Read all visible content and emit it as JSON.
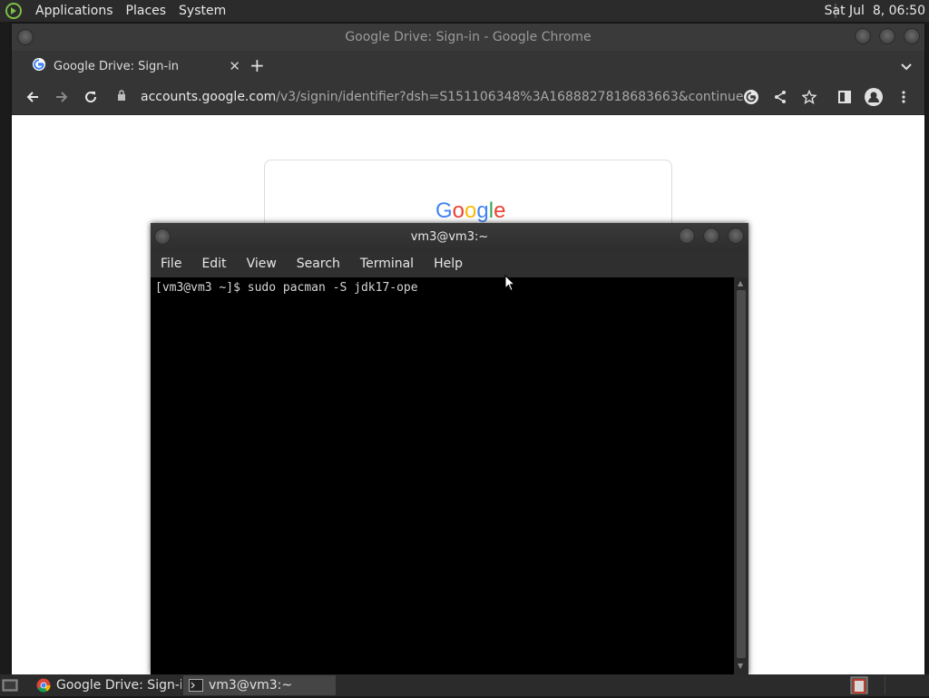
{
  "top_panel": {
    "menu": [
      "Applications",
      "Places",
      "System"
    ],
    "clock": "Sat Jul  8, 06:50",
    "logo_icon": "mate-logo-icon"
  },
  "chrome": {
    "window_title": "Google Drive: Sign-in - Google Chrome",
    "tab_title": "Google Drive: Sign-in",
    "url_host": "accounts.google.com",
    "url_path": "/v3/signin/identifier?dsh=S151106348%3A1688827818683663&continue=https%…",
    "google_logo": "Google",
    "logo_colors": [
      "#4285F4",
      "#EA4335",
      "#FBBC05",
      "#4285F4",
      "#34A853",
      "#EA4335"
    ]
  },
  "terminal": {
    "title": "vm3@vm3:~",
    "menu": [
      "File",
      "Edit",
      "View",
      "Search",
      "Terminal",
      "Help"
    ],
    "lines": [
      "[vm3@vm3 ~]$ sudo pacman -S jdk17-ope"
    ]
  },
  "taskbar": {
    "tasks": [
      "Google Drive: Sign-i...",
      "vm3@vm3:~"
    ]
  }
}
